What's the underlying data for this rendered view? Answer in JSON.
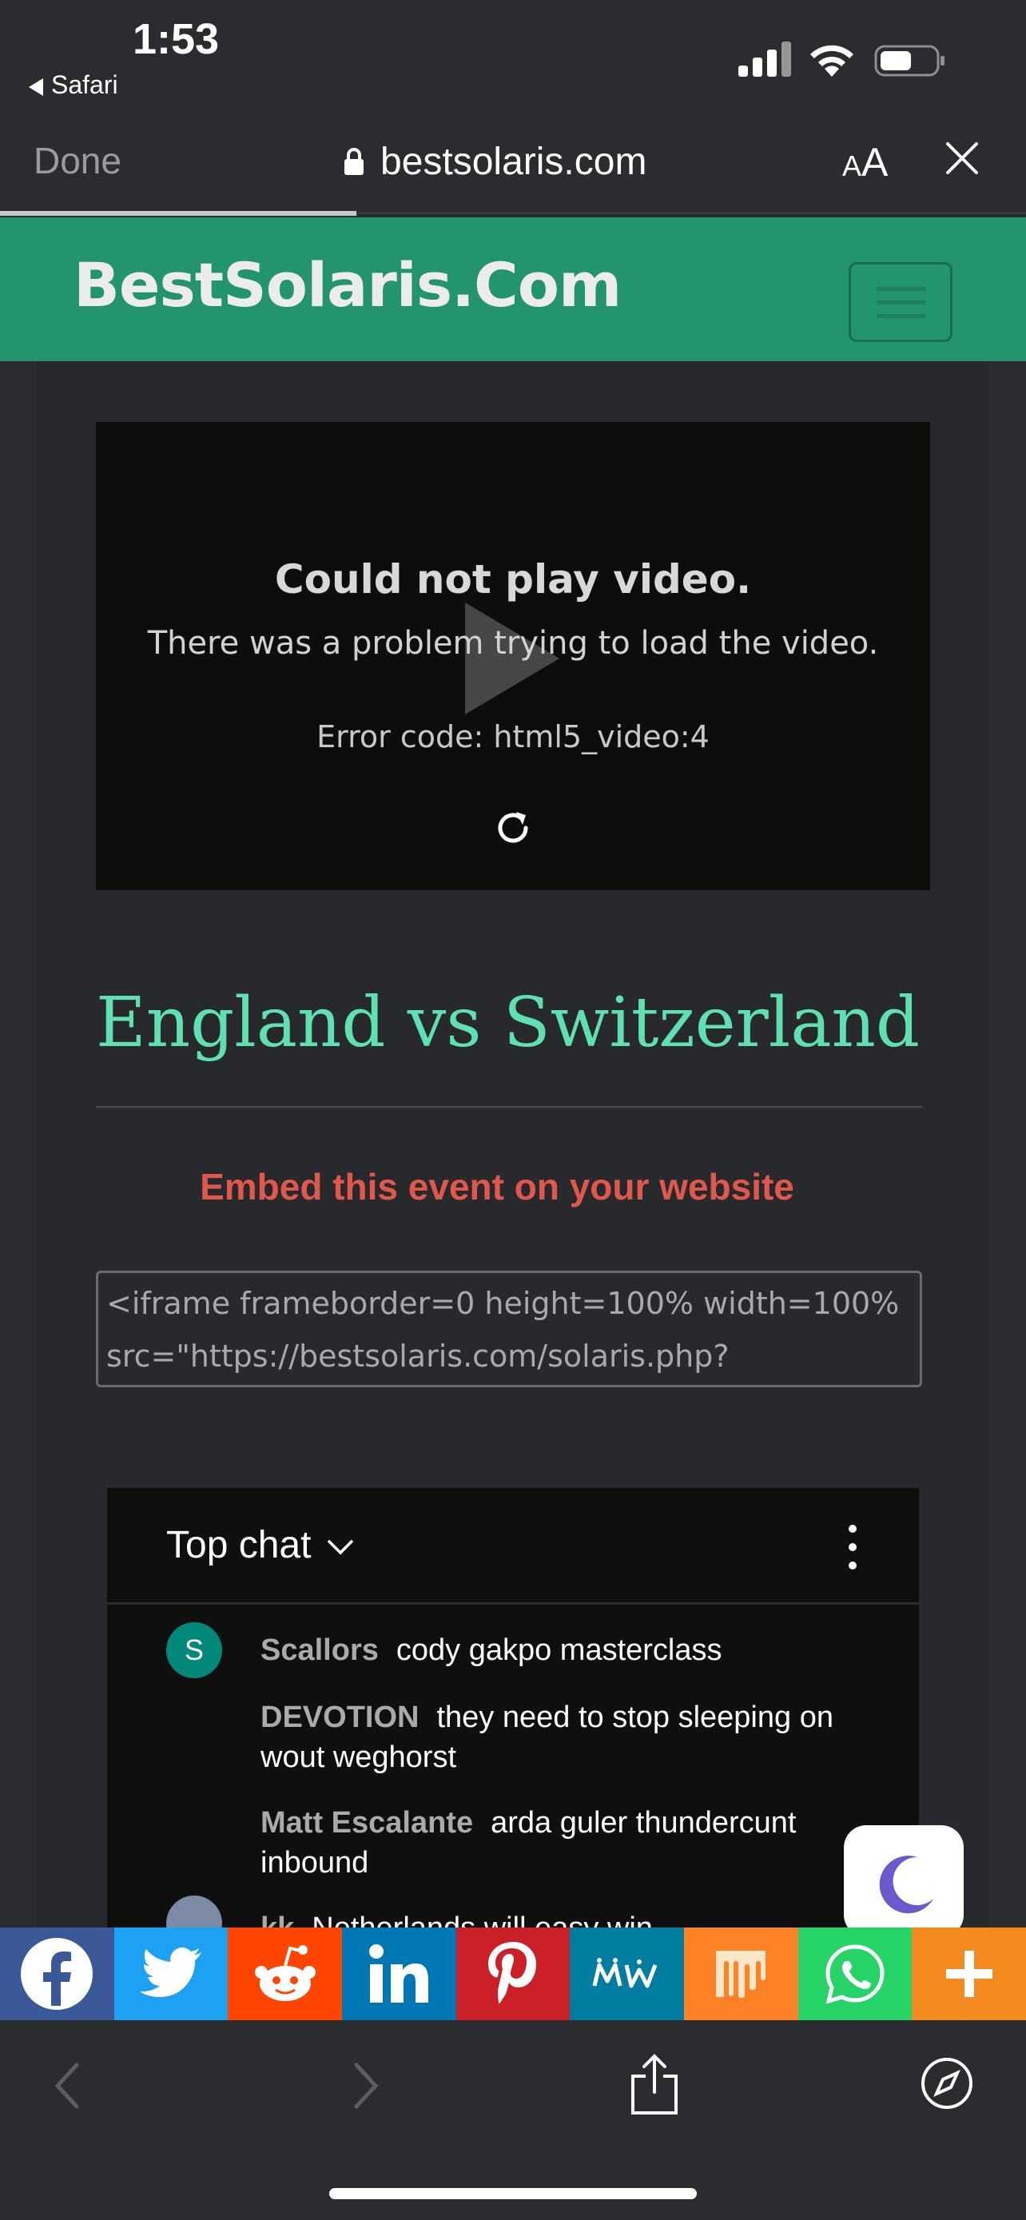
{
  "status": {
    "time": "1:53",
    "back_app": "Safari"
  },
  "safari": {
    "done_label": "Done",
    "url": "bestsolaris.com",
    "aa_small": "A",
    "aa_big": "A",
    "progress": 0.35
  },
  "site": {
    "brand": "BestSolaris.Com"
  },
  "video": {
    "error_title": "Could not play video.",
    "error_message": "There was a problem trying to load the video.",
    "error_code": "Error code: html5_video:4"
  },
  "event": {
    "title": "England vs Switzerland"
  },
  "embed": {
    "label": "Embed this event on your website",
    "code_line1": "<iframe frameborder=0 height=100% width=100%",
    "code_line2": "src=\"https://bestsolaris.com/solaris.php?"
  },
  "chat": {
    "header": "Top chat",
    "messages": [
      {
        "author": "Scallors",
        "text": "cody gakpo masterclass",
        "avatar_letter": "S"
      },
      {
        "author": "DEVOTION",
        "text": "they need to stop sleeping on wout weghorst"
      },
      {
        "author": "Matt Escalante",
        "text": "arda guler thundercunt inbound"
      },
      {
        "author": "kk",
        "text": "Netherlands will easy win"
      }
    ]
  },
  "share": {
    "items": [
      {
        "name": "facebook",
        "color": "#3b5998"
      },
      {
        "name": "twitter",
        "color": "#1da1f2"
      },
      {
        "name": "reddit",
        "color": "#ff4500"
      },
      {
        "name": "linkedin",
        "color": "#0077b5"
      },
      {
        "name": "pinterest",
        "color": "#cb2027"
      },
      {
        "name": "mewe",
        "color": "#007da1"
      },
      {
        "name": "mix",
        "color": "#ff8226"
      },
      {
        "name": "whatsapp",
        "color": "#25d366"
      },
      {
        "name": "more",
        "color": "#f58a1f"
      }
    ]
  },
  "colors": {
    "header_green": "#229570",
    "title_green": "#5ee0b4",
    "embed_red": "#e0584c",
    "background": "#2b2c30"
  }
}
